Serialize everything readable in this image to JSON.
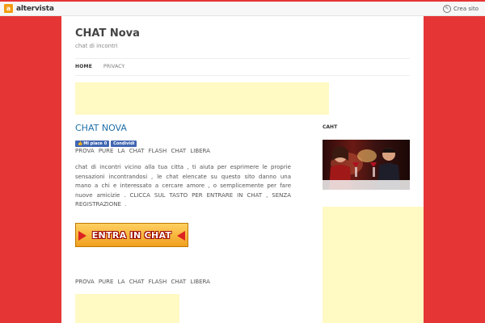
{
  "topbar": {
    "logo_mark": "a",
    "brand": "altervista",
    "create_site": "Crea sito"
  },
  "site": {
    "title": "CHAT Nova",
    "description": "chat di incontri"
  },
  "nav": {
    "home": "HOME",
    "privacy": "PRIVACY"
  },
  "post": {
    "title": "CHAT NOVA",
    "fb_like": "Mi piace",
    "fb_like_count": "0",
    "fb_share": "Condividi",
    "line1": "PROVA PURE LA CHAT FLASH CHAT LIBERA",
    "paragraph": "chat di incontri vicino alla tua citta , ti aiuta per esprimere le proprie sensazioni incontrandosi , le chat elencate su questo sito danno una mano a chi e interessato a cercare amore , o semplicemente per fare nuove amicizie . CLICCA SUL TASTO PER ENTRARE IN CHAT , SENZA REGISTRAZIONE .",
    "chat_button": "ENTRA IN CHAT",
    "line2": "PROVA PURE LA CHAT FLASH CHAT LIBERA"
  },
  "sidebar": {
    "title": "CAHT"
  },
  "colors": {
    "background": "#e53535",
    "ad": "#fff9c4",
    "link": "#1e6fa8",
    "facebook": "#4267b2"
  }
}
